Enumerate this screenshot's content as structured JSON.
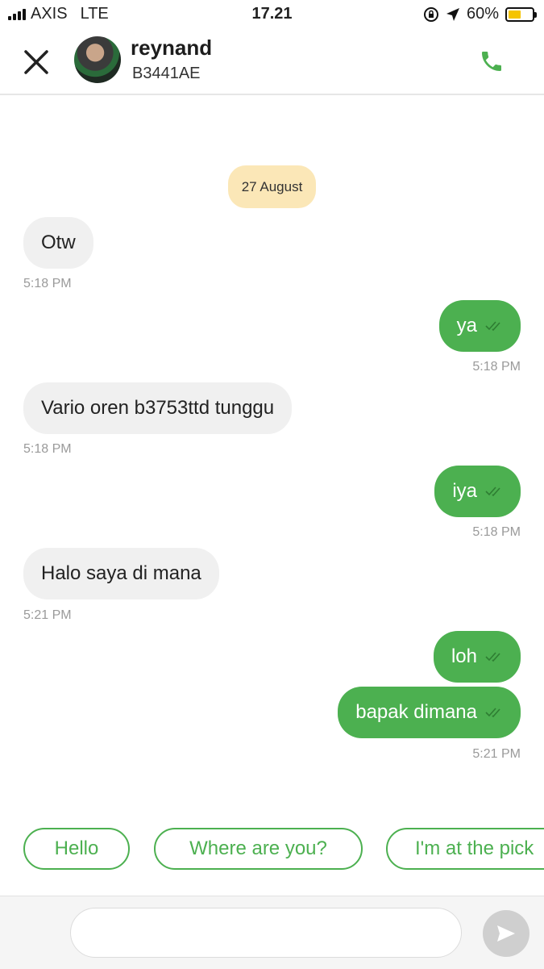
{
  "status_bar": {
    "carrier": "AXIS",
    "network": "LTE",
    "time": "17.21",
    "battery_percent": "60%",
    "battery_level": 0.6
  },
  "header": {
    "contact_name": "reynand",
    "plate": "B3441AE",
    "close_icon": "close-icon",
    "call_icon": "phone-icon",
    "accent_color": "#4cb050"
  },
  "chat": {
    "date_separator": "27 August",
    "messages": [
      {
        "direction": "incoming",
        "text": "Otw",
        "time": "5:18 PM"
      },
      {
        "direction": "outgoing",
        "text": "ya",
        "time": "5:18 PM"
      },
      {
        "direction": "incoming",
        "text": "Vario oren b3753ttd tunggu",
        "time": "5:18 PM"
      },
      {
        "direction": "outgoing",
        "text": "iya",
        "time": "5:18 PM"
      },
      {
        "direction": "incoming",
        "text": "Halo saya di mana",
        "time": "5:21 PM"
      },
      {
        "direction": "outgoing",
        "text": "loh",
        "time": ""
      },
      {
        "direction": "outgoing",
        "text": "bapak dimana",
        "time": "5:21 PM"
      }
    ]
  },
  "quick_replies": [
    "Hello",
    "Where are you?",
    "I'm at the pick"
  ],
  "composer": {
    "placeholder": "",
    "send_icon": "send-icon"
  }
}
